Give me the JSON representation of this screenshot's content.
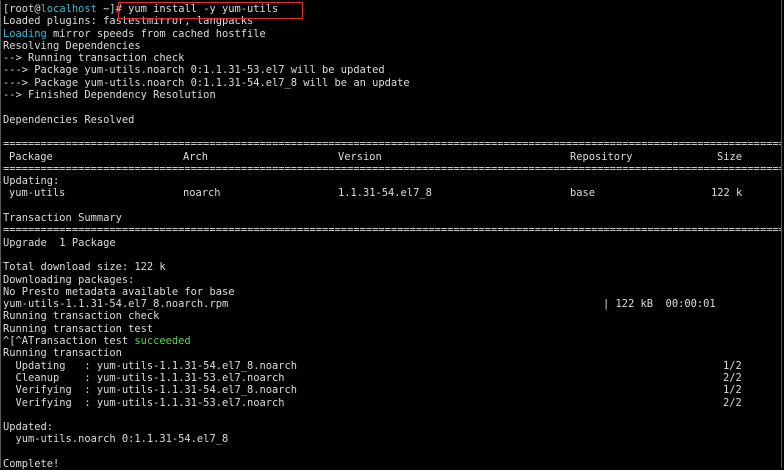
{
  "prompt": {
    "user": "[root@",
    "host": "localhost",
    "path": " ~]",
    "command": "# yum install -y yum-utils"
  },
  "output": {
    "loaded_plugins": "Loaded plugins: fastestmirror, langpacks",
    "loading_word": "Loading",
    "loading_rest": " mirror speeds from cached hostfile",
    "resolving": "Resolving Dependencies",
    "running_check": "--> Running transaction check",
    "pkg_updated": "---> Package yum-utils.noarch 0:1.1.31-53.el7 will be updated",
    "pkg_update": "---> Package yum-utils.noarch 0:1.1.31-54.el7_8 will be an update",
    "finished": "--> Finished Dependency Resolution",
    "deps_resolved": "Dependencies Resolved"
  },
  "table": {
    "headers": {
      "package": "Package",
      "arch": "Arch",
      "version": "Version",
      "repository": "Repository",
      "size": "Size"
    },
    "section_label": "Updating:",
    "row": {
      "package": "yum-utils",
      "arch": "noarch",
      "version": "1.1.31-54.el7_8",
      "repository": "base",
      "size": "122 k"
    }
  },
  "summary": {
    "title": "Transaction Summary",
    "upgrade": "Upgrade  1 Package",
    "total_download": "Total download size: 122 k",
    "downloading": "Downloading packages:",
    "no_presto": "No Presto metadata available for base",
    "rpm_name": "yum-utils-1.1.31-54.el7_8.noarch.rpm",
    "rpm_progress": "| 122 kB  00:00:01",
    "running_check": "Running transaction check",
    "running_test": "Running transaction test",
    "test_prefix": "^[^ATransaction test ",
    "test_result": "succeeded",
    "running_tx": "Running transaction"
  },
  "steps": [
    {
      "action": "  Updating   : yum-utils-1.1.31-54.el7_8.noarch",
      "progress": "1/2"
    },
    {
      "action": "  Cleanup    : yum-utils-1.1.31-53.el7.noarch",
      "progress": "2/2"
    },
    {
      "action": "  Verifying  : yum-utils-1.1.31-54.el7_8.noarch",
      "progress": "1/2"
    },
    {
      "action": "  Verifying  : yum-utils-1.1.31-53.el7.noarch",
      "progress": "2/2"
    }
  ],
  "result": {
    "updated_label": "Updated:",
    "updated_pkg": "  yum-utils.noarch 0:1.1.31-54.el7_8",
    "complete": "Complete!"
  },
  "separator": "================================================================================================================================",
  "colors": {
    "background": "#000000",
    "text": "#dcdcdc",
    "cyan": "#3fb8d8",
    "green": "#5ccf5c",
    "highlight_border": "#e03030"
  }
}
